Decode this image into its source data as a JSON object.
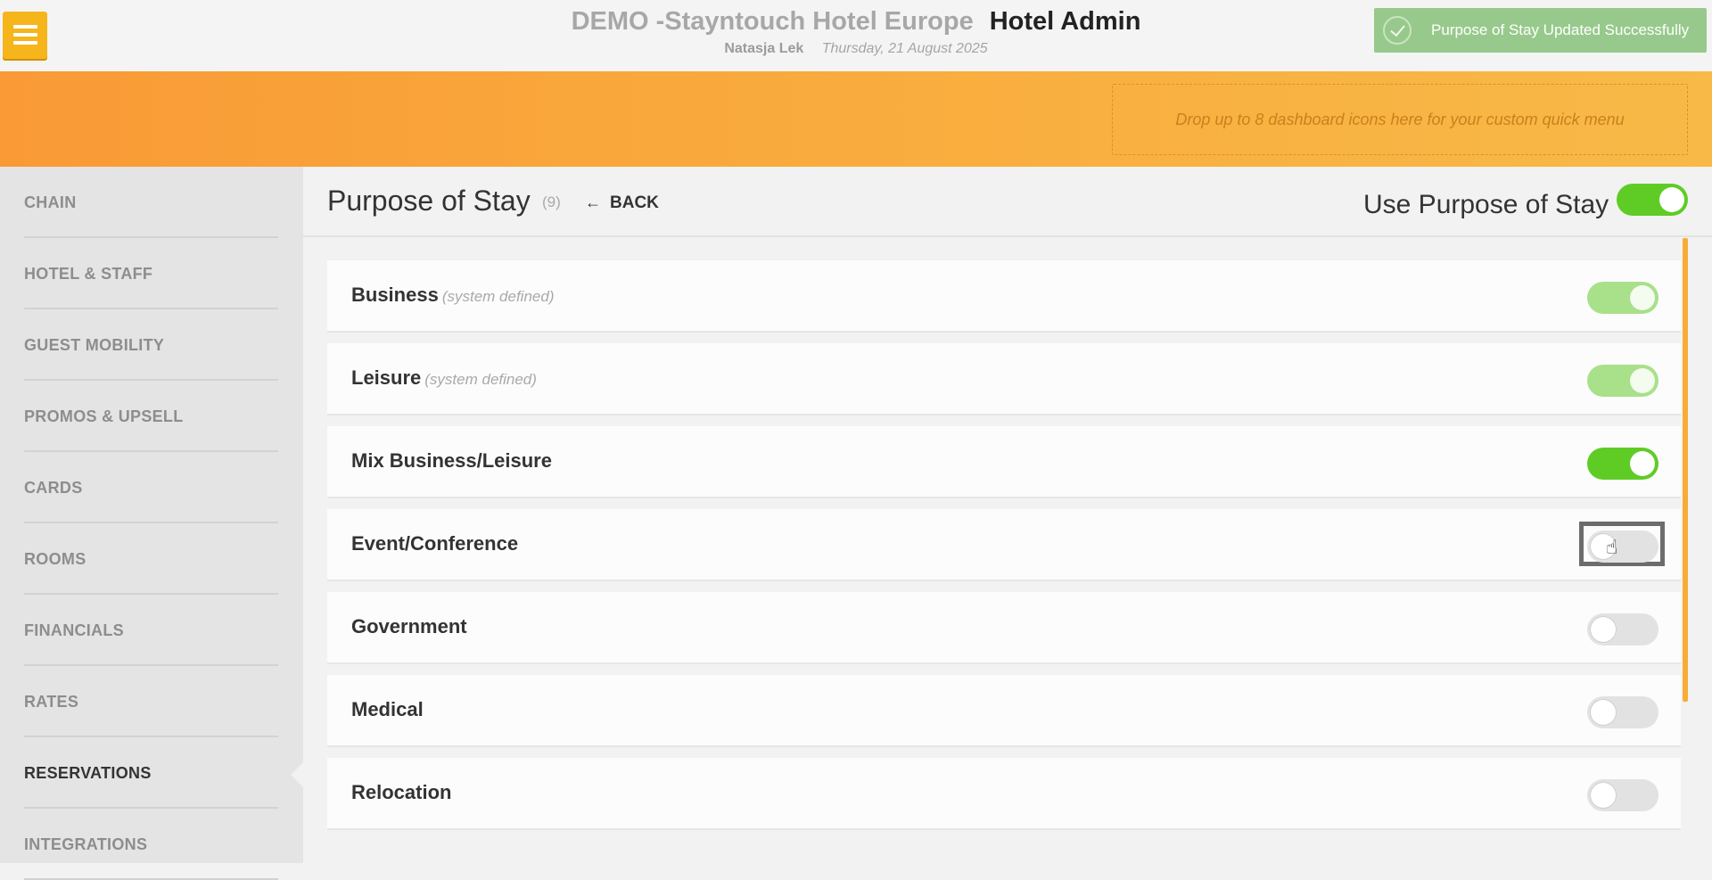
{
  "header": {
    "hotel_name": "DEMO -Stayntouch Hotel Europe",
    "app_name": "Hotel Admin",
    "user": "Natasja Lek",
    "date": "Thursday, 21 August 2025"
  },
  "toast": {
    "message": "Purpose of Stay Updated Successfully",
    "color": "#98c98c"
  },
  "quick_menu": {
    "placeholder": "Drop up to 8 dashboard icons here for your custom quick menu"
  },
  "sidebar": {
    "items": [
      {
        "label": "CHAIN"
      },
      {
        "label": "HOTEL & STAFF"
      },
      {
        "label": "GUEST MOBILITY"
      },
      {
        "label": "PROMOS & UPSELL"
      },
      {
        "label": "CARDS"
      },
      {
        "label": "ROOMS"
      },
      {
        "label": "FINANCIALS"
      },
      {
        "label": "RATES"
      },
      {
        "label": "RESERVATIONS",
        "active": true
      },
      {
        "label": "INTEGRATIONS"
      }
    ]
  },
  "page": {
    "title": "Purpose of Stay",
    "count": "(9)",
    "back_label": "BACK",
    "use_label": "Use Purpose of Stay",
    "use_enabled": true
  },
  "purposes": [
    {
      "name": "Business",
      "note": "(system defined)",
      "state": "on-disabled"
    },
    {
      "name": "Leisure",
      "note": "(system defined)",
      "state": "on-disabled"
    },
    {
      "name": "Mix Business/Leisure",
      "note": "",
      "state": "on"
    },
    {
      "name": "Event/Conference",
      "note": "",
      "state": "off",
      "focused": true
    },
    {
      "name": "Government",
      "note": "",
      "state": "off"
    },
    {
      "name": "Medical",
      "note": "",
      "state": "off"
    },
    {
      "name": "Relocation",
      "note": "",
      "state": "off"
    }
  ],
  "colors": {
    "accent_orange": "#f8a93b",
    "toggle_on": "#5fcc26",
    "toggle_on_disabled": "#a9e08a",
    "menu_button": "#f7b51c"
  }
}
